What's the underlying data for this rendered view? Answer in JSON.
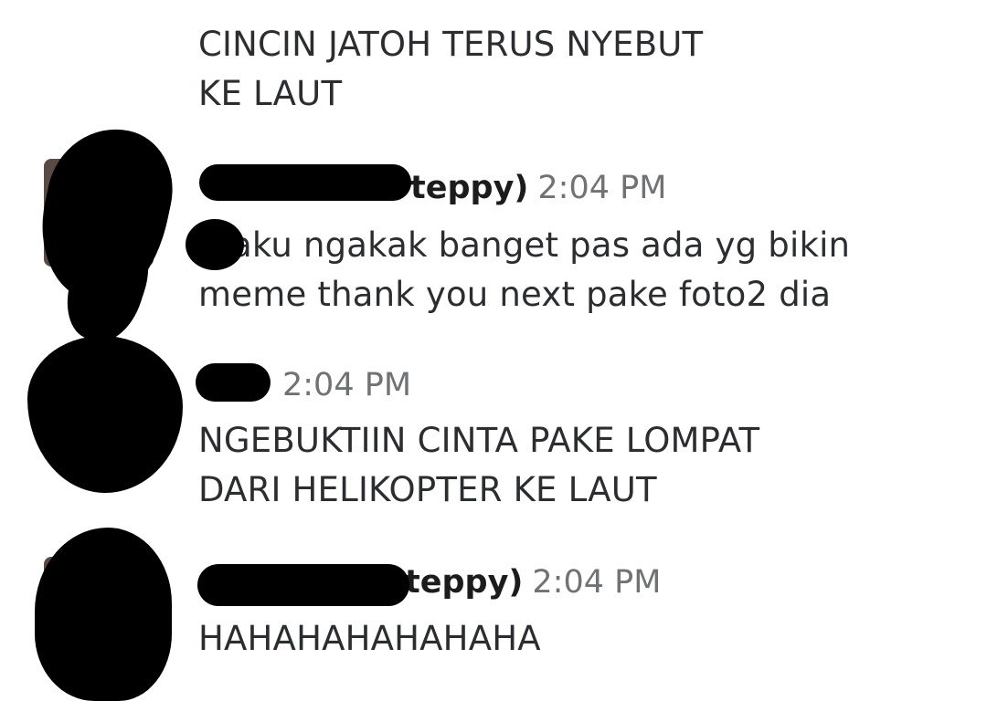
{
  "messages": [
    {
      "continuation": true,
      "lines": [
        "CINCIN JATOH TERUS NYEBUT",
        "KE LAUT"
      ]
    },
    {
      "sender_visible": "teppy)",
      "time": "2:04 PM",
      "lines": [
        "aku ngakak banget pas ada yg bikin",
        "meme thank you next pake foto2 dia"
      ]
    },
    {
      "sender_visible": "",
      "time": "2:04 PM",
      "lines": [
        "NGEBUKTIIN CINTA PAKE LOMPAT",
        "DARI HELIKOPTER KE LAUT"
      ]
    },
    {
      "sender_visible": "teppy)",
      "time": "2:04 PM",
      "lines": [
        "HAHAHAHAHAHAHA"
      ]
    }
  ]
}
